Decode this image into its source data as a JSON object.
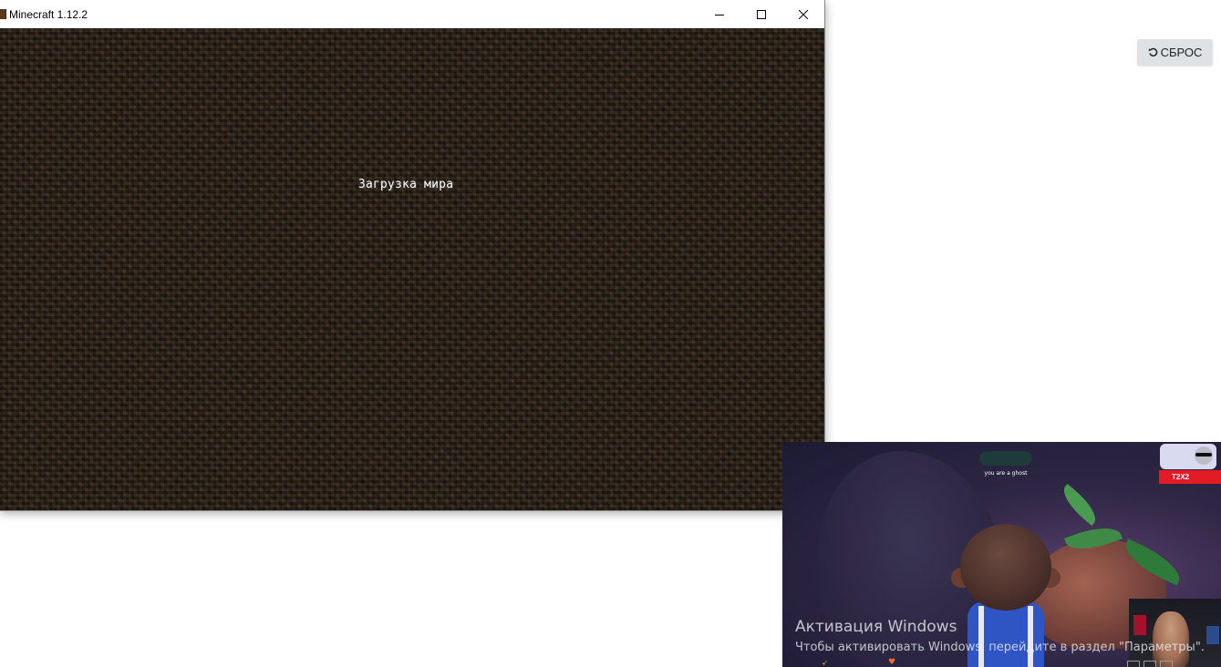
{
  "window": {
    "title": "Minecraft 1.12.2",
    "icon": "minecraft-icon",
    "controls": [
      "minimize-icon",
      "maximize-icon",
      "close-icon"
    ]
  },
  "game": {
    "loading_text": "Загрузка мира",
    "background_color": "#2b2016"
  },
  "reset_button": {
    "label": "СБРОС",
    "icon": "undo-icon"
  },
  "stream": {
    "npc_dialog_line1": "you are a ghost",
    "npc_badge_text": "T2X2"
  },
  "windows_activation": {
    "title": "Активация Windows",
    "subtitle": "Чтобы активировать Windows, перейдите в раздел \"Параметры\"."
  },
  "colors": {
    "accent_red": "#e31b24",
    "reset_button_bg": "#dfe2e5"
  }
}
